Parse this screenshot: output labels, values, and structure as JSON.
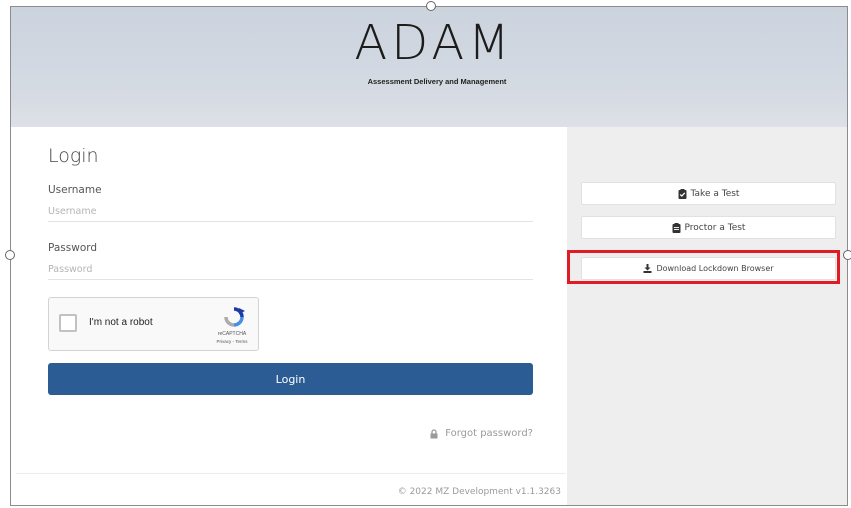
{
  "logo": {
    "wordmark": "ADAM",
    "tagline": "Assessment Delivery and Management"
  },
  "login": {
    "title": "Login",
    "username_label": "Username",
    "username_placeholder": "Username",
    "username_value": "",
    "password_label": "Password",
    "password_placeholder": "Password",
    "password_value": "",
    "captcha": {
      "label": "I'm not a robot",
      "brand": "reCAPTCHA",
      "links": "Privacy - Terms",
      "checked": false
    },
    "submit_label": "Login",
    "forgot_label": "Forgot password?",
    "copyright": "© 2022 MZ Development v1.1.3263"
  },
  "side": {
    "buttons": [
      {
        "label": "Take a Test",
        "icon": "clipboard-check-icon"
      },
      {
        "label": "Proctor a Test",
        "icon": "clipboard-icon"
      },
      {
        "label": "Download Lockdown Browser",
        "icon": "download-icon"
      }
    ]
  },
  "colors": {
    "primary": "#2b5c93",
    "header_bg": "#d0d7e0",
    "side_bg": "#eeeeef",
    "highlight": "#e01b24"
  }
}
